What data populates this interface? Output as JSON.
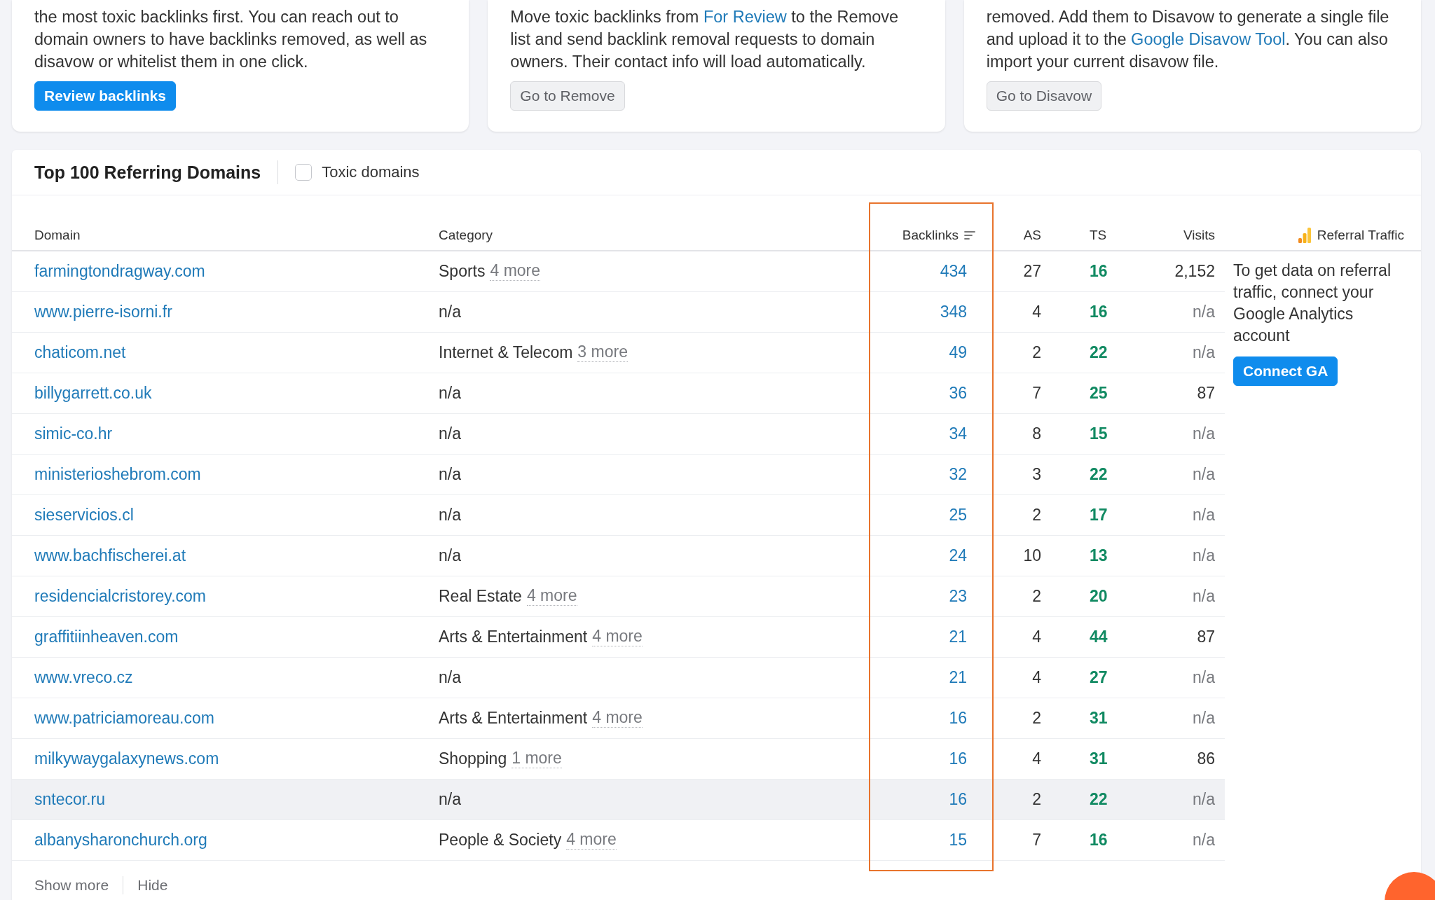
{
  "cards": [
    {
      "paragraph": [
        {
          "kind": "text",
          "text": "the most toxic backlinks first. You can reach out to domain owners to have backlinks removed, as well as disavow or whitelist them in one click."
        }
      ],
      "button": {
        "label": "Review backlinks",
        "kind": "primary"
      }
    },
    {
      "paragraph": [
        {
          "kind": "text",
          "text": "Move toxic backlinks from "
        },
        {
          "kind": "link",
          "text": "For Review"
        },
        {
          "kind": "text",
          "text": " to the Remove list and send backlink removal requests to domain owners. Their contact info will load automatically."
        }
      ],
      "button": {
        "label": "Go to Remove",
        "kind": "secondary"
      }
    },
    {
      "paragraph": [
        {
          "kind": "text",
          "text": "removed. Add them to Disavow to generate a single file and upload it to the "
        },
        {
          "kind": "link",
          "text": "Google Disavow Tool"
        },
        {
          "kind": "text",
          "text": ". You can also import your current disavow file."
        }
      ],
      "button": {
        "label": "Go to Disavow",
        "kind": "secondary"
      }
    }
  ],
  "domains_panel": {
    "title": "Top 100 Referring Domains",
    "toxic_filter": {
      "label": "Toxic domains",
      "checked": false
    },
    "columns": [
      {
        "label": "Domain",
        "sorted": false
      },
      {
        "label": "Category",
        "sorted": false
      },
      {
        "label": "Backlinks",
        "sorted": true
      },
      {
        "label": "AS",
        "sorted": false
      },
      {
        "label": "TS",
        "sorted": false
      },
      {
        "label": "Visits",
        "sorted": false
      }
    ],
    "referral_column": {
      "label": "Referral Traffic",
      "message": "To get data on referral traffic, connect your Google Analytics account",
      "button": "Connect GA"
    },
    "rows": [
      {
        "domain": "farmingtondragway.com",
        "category": "Sports",
        "more": "4 more",
        "backlinks": "434",
        "as": "27",
        "ts": "16",
        "visits": "2,152",
        "hovered": false
      },
      {
        "domain": "www.pierre-isorni.fr",
        "category": "n/a",
        "backlinks": "348",
        "as": "4",
        "ts": "16",
        "visits": "n/a",
        "hovered": false
      },
      {
        "domain": "chaticom.net",
        "category": "Internet & Telecom",
        "more": "3 more",
        "backlinks": "49",
        "as": "2",
        "ts": "22",
        "visits": "n/a",
        "hovered": false
      },
      {
        "domain": "billygarrett.co.uk",
        "category": "n/a",
        "backlinks": "36",
        "as": "7",
        "ts": "25",
        "visits": "87",
        "hovered": false
      },
      {
        "domain": "simic-co.hr",
        "category": "n/a",
        "backlinks": "34",
        "as": "8",
        "ts": "15",
        "visits": "n/a",
        "hovered": false
      },
      {
        "domain": "ministerioshebrom.com",
        "category": "n/a",
        "backlinks": "32",
        "as": "3",
        "ts": "22",
        "visits": "n/a",
        "hovered": false
      },
      {
        "domain": "sieservicios.cl",
        "category": "n/a",
        "backlinks": "25",
        "as": "2",
        "ts": "17",
        "visits": "n/a",
        "hovered": false
      },
      {
        "domain": "www.bachfischerei.at",
        "category": "n/a",
        "backlinks": "24",
        "as": "10",
        "ts": "13",
        "visits": "n/a",
        "hovered": false
      },
      {
        "domain": "residencialcristorey.com",
        "category": "Real Estate",
        "more": "4 more",
        "backlinks": "23",
        "as": "2",
        "ts": "20",
        "visits": "n/a",
        "hovered": false
      },
      {
        "domain": "graffitiinheaven.com",
        "category": "Arts & Entertainment",
        "more": "4 more",
        "backlinks": "21",
        "as": "4",
        "ts": "44",
        "visits": "87",
        "hovered": false
      },
      {
        "domain": "www.vreco.cz",
        "category": "n/a",
        "backlinks": "21",
        "as": "4",
        "ts": "27",
        "visits": "n/a",
        "hovered": false
      },
      {
        "domain": "www.patriciamoreau.com",
        "category": "Arts & Entertainment",
        "more": "4 more",
        "backlinks": "16",
        "as": "2",
        "ts": "31",
        "visits": "n/a",
        "hovered": false
      },
      {
        "domain": "milkywaygalaxynews.com",
        "category": "Shopping",
        "more": "1 more",
        "backlinks": "16",
        "as": "4",
        "ts": "31",
        "visits": "86",
        "hovered": false
      },
      {
        "domain": "sntecor.ru",
        "category": "n/a",
        "backlinks": "16",
        "as": "2",
        "ts": "22",
        "visits": "n/a",
        "hovered": true
      },
      {
        "domain": "albanysharonchurch.org",
        "category": "People & Society",
        "more": "4 more",
        "backlinks": "15",
        "as": "7",
        "ts": "16",
        "visits": "n/a",
        "hovered": false
      }
    ],
    "footer_links": [
      "Show more",
      "Hide"
    ]
  }
}
